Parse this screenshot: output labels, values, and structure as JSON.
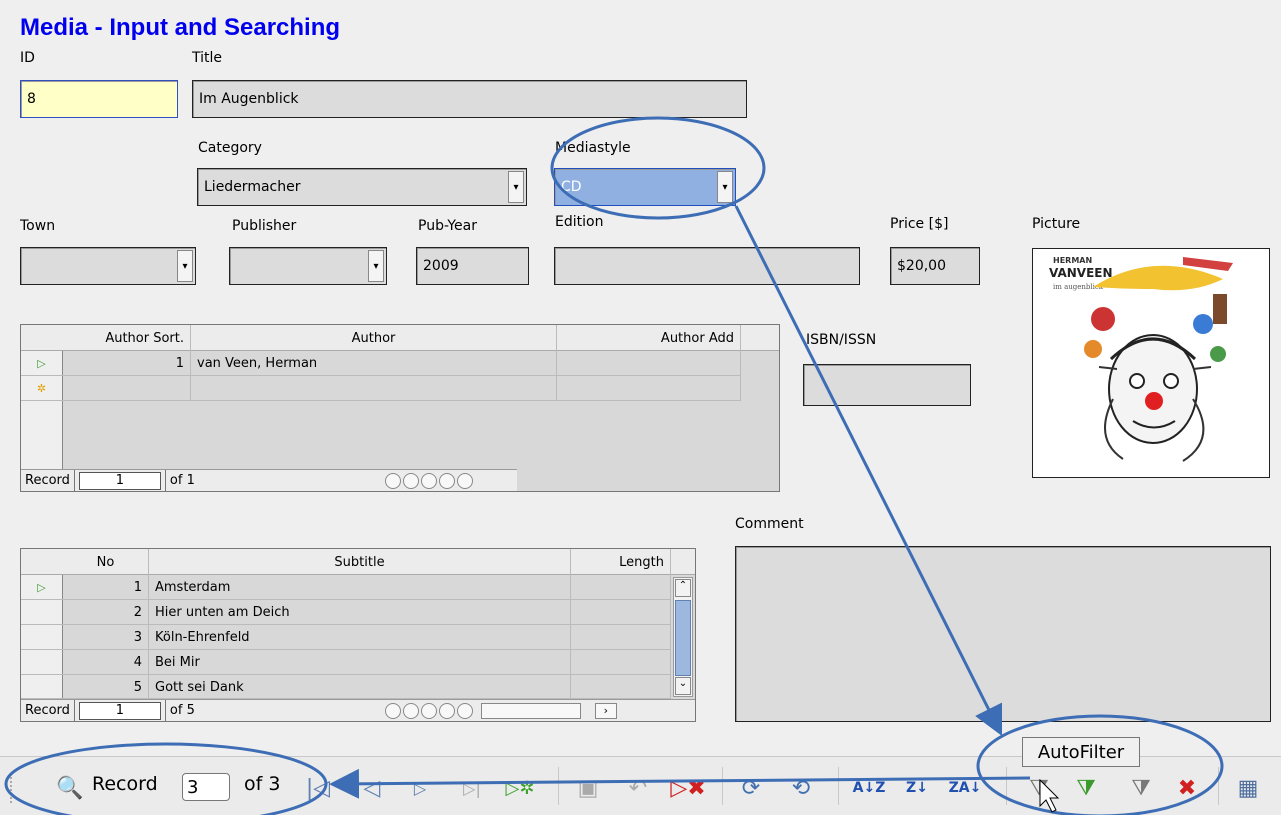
{
  "form": {
    "title": "Media - Input and Searching",
    "labels": {
      "id": "ID",
      "title": "Title",
      "category": "Category",
      "mediastyle": "Mediastyle",
      "town": "Town",
      "publisher": "Publisher",
      "pubyear": "Pub-Year",
      "edition": "Edition",
      "price": "Price [$]",
      "picture": "Picture",
      "isbn": "ISBN/ISSN",
      "comment": "Comment"
    },
    "values": {
      "id": "8",
      "title": "Im Augenblick",
      "category": "Liedermacher",
      "mediastyle": "CD",
      "town": "",
      "publisher": "",
      "pubyear": "2009",
      "edition": "",
      "price": "$20,00",
      "isbn": "",
      "comment": ""
    }
  },
  "author_grid": {
    "columns": [
      "Author Sort.",
      "Author",
      "Author Add"
    ],
    "rows": [
      {
        "marker": "▷",
        "sort": "1",
        "author": "van Veen, Herman",
        "add": ""
      },
      {
        "marker": "✲",
        "sort": "",
        "author": "",
        "add": ""
      }
    ],
    "nav": {
      "record_label": "Record",
      "record_num": "1",
      "of_label": "of 1"
    }
  },
  "subtitle_grid": {
    "columns": [
      "No",
      "Subtitle",
      "Length"
    ],
    "rows": [
      {
        "marker": "▷",
        "no": "1",
        "subtitle": "Amsterdam",
        "length": ""
      },
      {
        "marker": "",
        "no": "2",
        "subtitle": "Hier unten am Deich",
        "length": ""
      },
      {
        "marker": "",
        "no": "3",
        "subtitle": "Köln-Ehrenfeld",
        "length": ""
      },
      {
        "marker": "",
        "no": "4",
        "subtitle": "Bei Mir",
        "length": ""
      },
      {
        "marker": "",
        "no": "5",
        "subtitle": "Gott sei Dank",
        "length": ""
      }
    ],
    "nav": {
      "record_label": "Record",
      "record_num": "1",
      "of_label": "of 5"
    }
  },
  "picture": {
    "line1": "HERMAN",
    "line2": "VANVEEN",
    "line3": "im augenblick"
  },
  "toolbar": {
    "record_label": "Record",
    "record_value": "3",
    "of_label": "of 3",
    "tooltip": "AutoFilter",
    "icons": [
      "find-icon",
      "first-record-icon",
      "previous-record-icon",
      "next-record-icon",
      "last-record-icon",
      "new-record-icon",
      "save-record-icon",
      "undo-icon",
      "delete-record-icon",
      "refresh-icon",
      "refresh-control-icon",
      "sort-ascending-icon",
      "sort-descending-icon",
      "sort-icon",
      "autofilter-icon",
      "apply-filter-icon",
      "standard-filter-icon",
      "reset-filter-icon",
      "data-source-icon"
    ]
  },
  "annotation_color": "#3d6db5"
}
